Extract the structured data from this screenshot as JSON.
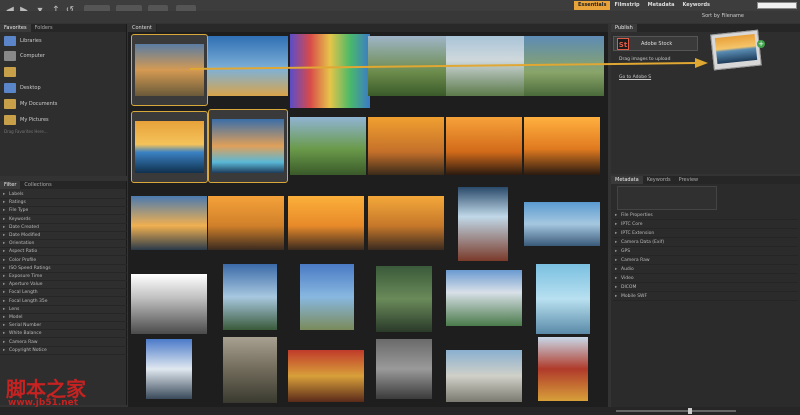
{
  "workspaces": [
    "Essentials",
    "Filmstrip",
    "Metadata",
    "Keywords"
  ],
  "sort": {
    "label": "Sort by Filename"
  },
  "left_top": {
    "tabs": [
      "Favorites",
      "Folders"
    ],
    "items": [
      "Libraries",
      "Computer",
      "",
      "Desktop",
      "My Documents",
      "My Pictures"
    ],
    "drag_hint": "Drag Favorites Here..."
  },
  "left_bottom": {
    "tabs": [
      "Filter",
      "Collections"
    ],
    "rows": [
      "Labels",
      "Ratings",
      "File Type",
      "Keywords",
      "Date Created",
      "Date Modified",
      "Orientation",
      "Aspect Ratio",
      "Color Profile",
      "ISO Speed Ratings",
      "Exposure Time",
      "Aperture Value",
      "Focal Length",
      "Focal Length 35e",
      "Lens",
      "Model",
      "Serial Number",
      "White Balance",
      "Camera Raw",
      "Copyright Notice"
    ]
  },
  "content": {
    "tab": "Content"
  },
  "publish": {
    "tab": "Publish",
    "service": "Adobe Stock",
    "logo": "St",
    "drag_text": "Drag images to upload",
    "link": "Go to Adobe S"
  },
  "metadata": {
    "tabs": [
      "Metadata",
      "Keywords",
      "Preview"
    ],
    "sections": [
      "File Properties",
      "IPTC Core",
      "IPTC Extension",
      "Camera Data (Exif)",
      "GPS",
      "Camera Raw",
      "Audio",
      "Video",
      "DICOM",
      "Mobile SWF"
    ]
  },
  "watermark": {
    "text": "脚本之家",
    "url": "www.jb51.net"
  },
  "colors": {
    "accent": "#e8a33a",
    "selection": "#d9a83a"
  }
}
